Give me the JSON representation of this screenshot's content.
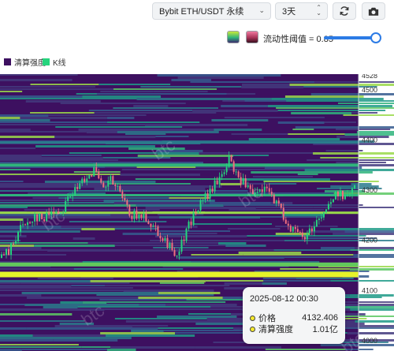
{
  "toolbar": {
    "market_select": "Bybit ETH/USDT 永续",
    "range_select": "3天"
  },
  "controls": {
    "liquidity_label": "流动性阈值 = 0.85",
    "liquidity_threshold": 0.85
  },
  "legend": {
    "items": [
      {
        "label": "清算强度",
        "color": "#3d1060"
      },
      {
        "label": "K线",
        "color": "#26d47d"
      }
    ]
  },
  "chart_data": {
    "type": "heatmap",
    "y_ticks": [
      "4528",
      "4500",
      "4400",
      "4300",
      "4200",
      "4100",
      "4000"
    ],
    "ylim": [
      4000,
      4528
    ],
    "candles_close_path": [
      4165,
      4180,
      4220,
      4235,
      4250,
      4240,
      4262,
      4255,
      4290,
      4300,
      4330,
      4340,
      4300,
      4320,
      4295,
      4260,
      4245,
      4250,
      4230,
      4210,
      4185,
      4175,
      4220,
      4255,
      4280,
      4300,
      4325,
      4360,
      4330,
      4310,
      4285,
      4300,
      4295,
      4265,
      4235,
      4215,
      4205,
      4228,
      4250,
      4270,
      4295,
      4290,
      4300
    ],
    "watermark": "btc"
  },
  "tooltip": {
    "date": "2025-08-12 00:30",
    "price_label": "价格",
    "price_value": "4132.406",
    "intensity_label": "清算强度",
    "intensity_value": "1.01亿"
  },
  "colors": {
    "heat_low": "#3d1060",
    "heat_mid": "#2fb47c",
    "heat_high": "#e6f32a",
    "candle_up": "#26d47d",
    "candle_down": "#ef6f7f",
    "accent": "#2c7be5"
  }
}
